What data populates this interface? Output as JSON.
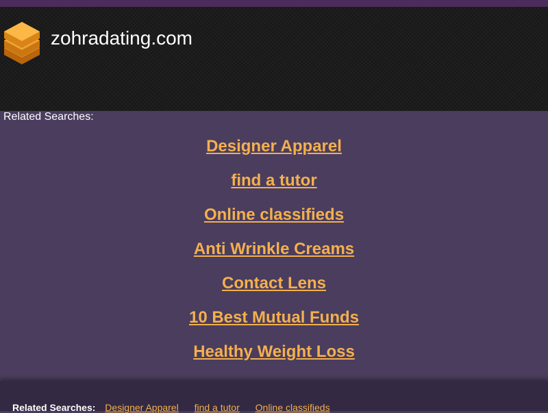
{
  "header": {
    "logo_icon": "stacked-layers-icon",
    "site_title": "zohradating.com"
  },
  "main": {
    "related_label": "Related Searches:",
    "links": [
      "Designer Apparel",
      "find a tutor",
      "Online classifieds",
      "Anti Wrinkle Creams",
      "Contact Lens",
      "10 Best Mutual Funds",
      "Healthy Weight Loss"
    ]
  },
  "footer": {
    "related_label": "Related Searches:",
    "links": [
      "Designer Apparel",
      "find a tutor",
      "Online classifieds"
    ]
  },
  "colors": {
    "top_strip": "#4c2c5c",
    "header_bg": "#1c1c1c",
    "main_bg": "#4a3d5e",
    "link": "#f4b04d",
    "footer_bg": "#332942"
  }
}
